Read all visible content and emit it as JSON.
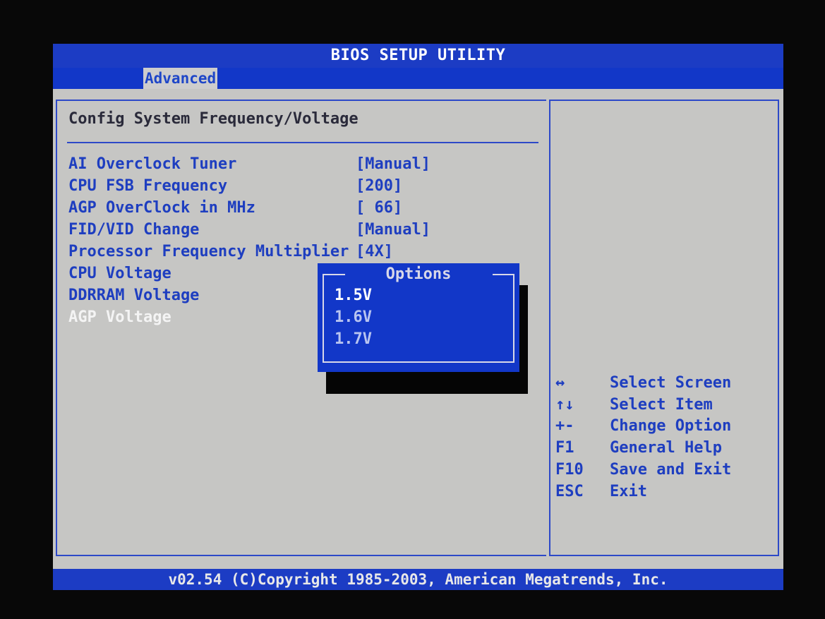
{
  "title": "BIOS SETUP UTILITY",
  "tabs": [
    {
      "label": "Advanced",
      "active": true
    }
  ],
  "section_title": "Config System Frequency/Voltage",
  "settings": [
    {
      "label": "AI Overclock Tuner",
      "value": "[Manual]"
    },
    {
      "label": "CPU FSB Frequency",
      "value": "[200]"
    },
    {
      "label": "AGP OverClock in MHz",
      "value": "[ 66]"
    },
    {
      "label": "FID/VID Change",
      "value": "[Manual]"
    },
    {
      "label": "Processor Frequency Multiplier",
      "value": "[4X]"
    },
    {
      "label": "CPU Voltage",
      "value": ""
    },
    {
      "label": "DDRRAM Voltage",
      "value": ""
    },
    {
      "label": "AGP Voltage",
      "value": "",
      "selected": true
    }
  ],
  "options_popup": {
    "title": "Options",
    "options": [
      "1.5V",
      "1.6V",
      "1.7V"
    ],
    "current_index": 0
  },
  "help": [
    {
      "key": "↔",
      "desc": "Select Screen"
    },
    {
      "key": "↑↓",
      "desc": "Select Item"
    },
    {
      "key": "+-",
      "desc": "Change Option"
    },
    {
      "key": "F1",
      "desc": "General Help"
    },
    {
      "key": "F10",
      "desc": "Save and Exit"
    },
    {
      "key": "ESC",
      "desc": "Exit"
    }
  ],
  "status": "v02.54 (C)Copyright 1985-2003, American Megatrends, Inc.",
  "colors": {
    "bar_blue": "#1c3cc4",
    "panel_grey": "#c6c6c4",
    "text_blue": "#1e3ec0",
    "highlight_white": "#f4f4f4"
  }
}
